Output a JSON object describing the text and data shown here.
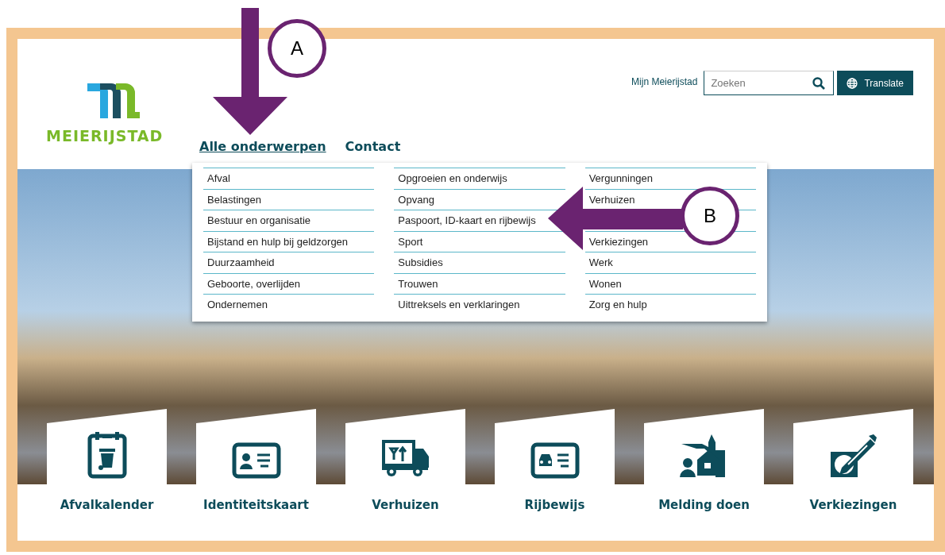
{
  "header": {
    "logo_text": "MEIERIJSTAD",
    "nav": [
      {
        "label": "Alle onderwerpen",
        "selected": true
      },
      {
        "label": "Contact",
        "selected": false
      }
    ],
    "account_link": "Mijn Meierijstad",
    "search": {
      "placeholder": "Zoeken"
    },
    "translate_button": "Translate"
  },
  "menu": {
    "columns": [
      [
        "Afval",
        "Belastingen",
        "Bestuur en organisatie",
        "Bijstand en hulp bij geldzorgen",
        "Duurzaamheid",
        "Geboorte, overlijden",
        "Ondernemen"
      ],
      [
        "Opgroeien en onderwijs",
        "Opvang",
        "Paspoort, ID-kaart en rijbewijs",
        "Sport",
        "Subsidies",
        "Trouwen",
        "Uittreksels en verklaringen"
      ],
      [
        "Vergunningen",
        "Verhuizen",
        null,
        "Verkiezingen",
        "Werk",
        "Wonen",
        "Zorg en hulp"
      ]
    ]
  },
  "tiles": [
    {
      "kind": "calendar",
      "label": "Afvalkalender"
    },
    {
      "kind": "idcard",
      "label": "Identiteitskaart"
    },
    {
      "kind": "truck",
      "label": "Verhuizen"
    },
    {
      "kind": "license",
      "label": "Rijbewijs"
    },
    {
      "kind": "report",
      "label": "Melding doen"
    },
    {
      "kind": "vote",
      "label": "Verkiezingen"
    }
  ],
  "annotations": [
    {
      "label": "A",
      "kind": "down"
    },
    {
      "label": "B",
      "kind": "left"
    }
  ]
}
